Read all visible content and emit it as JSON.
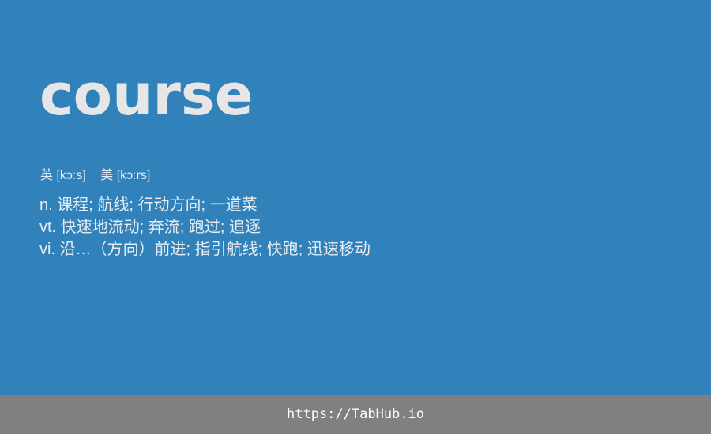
{
  "word": "course",
  "phonetics": {
    "uk": "英 [kɔːs]",
    "us": "美 [kɔːrs]"
  },
  "definitions": [
    "n. 课程; 航线; 行动方向; 一道菜",
    "vt. 快速地流动; 奔流; 跑过; 追逐",
    "vi. 沿…（方向）前进; 指引航线; 快跑; 迅速移动"
  ],
  "footer": {
    "url": "https://TabHub.io"
  },
  "colors": {
    "background": "#3182bb",
    "footer": "#808080",
    "word": "#e6e6e6"
  }
}
